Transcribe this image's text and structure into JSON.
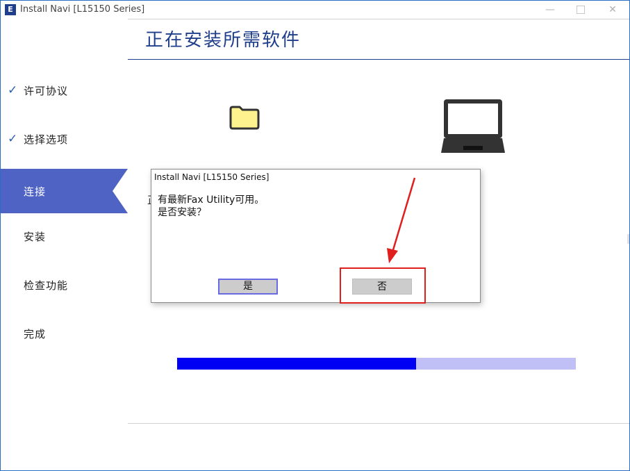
{
  "window": {
    "app_icon": "E",
    "title": "Install Navi [L15150 Series]",
    "minimize_glyph": "—",
    "close_glyph": "✕"
  },
  "page": {
    "title": "正在安装所需软件",
    "partial_text": "正"
  },
  "sidebar": {
    "steps": [
      {
        "label": "许可协议",
        "checked": true,
        "active": false
      },
      {
        "label": "选择选项",
        "checked": true,
        "active": false
      },
      {
        "label": "连接",
        "checked": false,
        "active": true
      },
      {
        "label": "安装",
        "checked": false,
        "active": false
      },
      {
        "label": "检查功能",
        "checked": false,
        "active": false
      },
      {
        "label": "完成",
        "checked": false,
        "active": false
      }
    ],
    "check_glyph": "✓",
    "active_color": "#4e63c4"
  },
  "icons": {
    "source": "folder-icon",
    "target": "laptop-icon"
  },
  "progress": {
    "fraction": 0.6,
    "fill_color": "#0000f5",
    "track_color": "#c0c0f7"
  },
  "dialog": {
    "title": "Install Navi [L15150 Series]",
    "message_line1": "有最新Fax Utility可用。",
    "message_line2": "是否安装？",
    "yes_label": "是",
    "no_label": "否"
  },
  "annotation": {
    "color": "#e01e1e"
  }
}
